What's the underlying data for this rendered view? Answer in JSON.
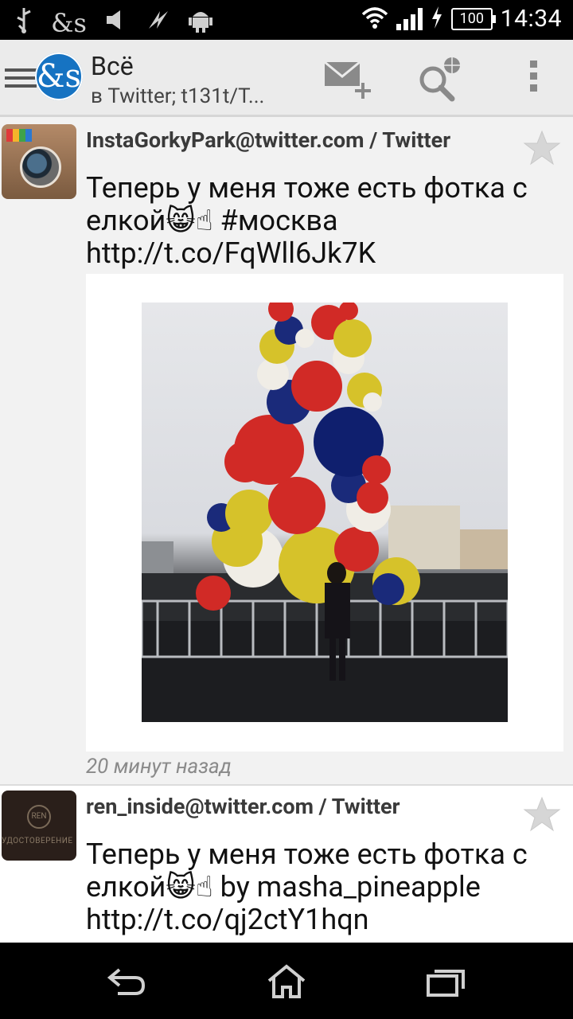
{
  "status_bar": {
    "time": "14:34",
    "battery": "100",
    "icons": [
      "usb-icon",
      "ampersand-app-icon",
      "muted-icon",
      "flash-icon",
      "android-icon",
      "wifi-icon",
      "signal-icon",
      "charging-icon",
      "battery-icon"
    ]
  },
  "action_bar": {
    "title": "Всё",
    "subtitle": "в Twitter; t131t/T...",
    "icons": [
      "menu-icon",
      "app-logo-icon",
      "compose-icon",
      "search-icon",
      "overflow-icon"
    ]
  },
  "tweets": [
    {
      "author": "InstaGorkyPark@twitter.com / Twitter",
      "text": "Теперь у меня тоже есть фотка с елкой😸☝ #москва http://t.co/FqWll6Jk7K",
      "time": "20 минут назад",
      "has_image": true
    },
    {
      "author": "ren_inside@twitter.com / Twitter",
      "text": "Теперь у меня тоже есть фотка с елкой😸☝ by masha_pineapple http://t.co/qj2ctY1hqn"
    }
  ],
  "avatar_text": {
    "ren_logo": "REN",
    "ren_caption": "УДОСТОВЕРЕНИЕ"
  },
  "nav_bar": {
    "buttons": [
      "back-icon",
      "home-icon",
      "recents-icon"
    ]
  }
}
